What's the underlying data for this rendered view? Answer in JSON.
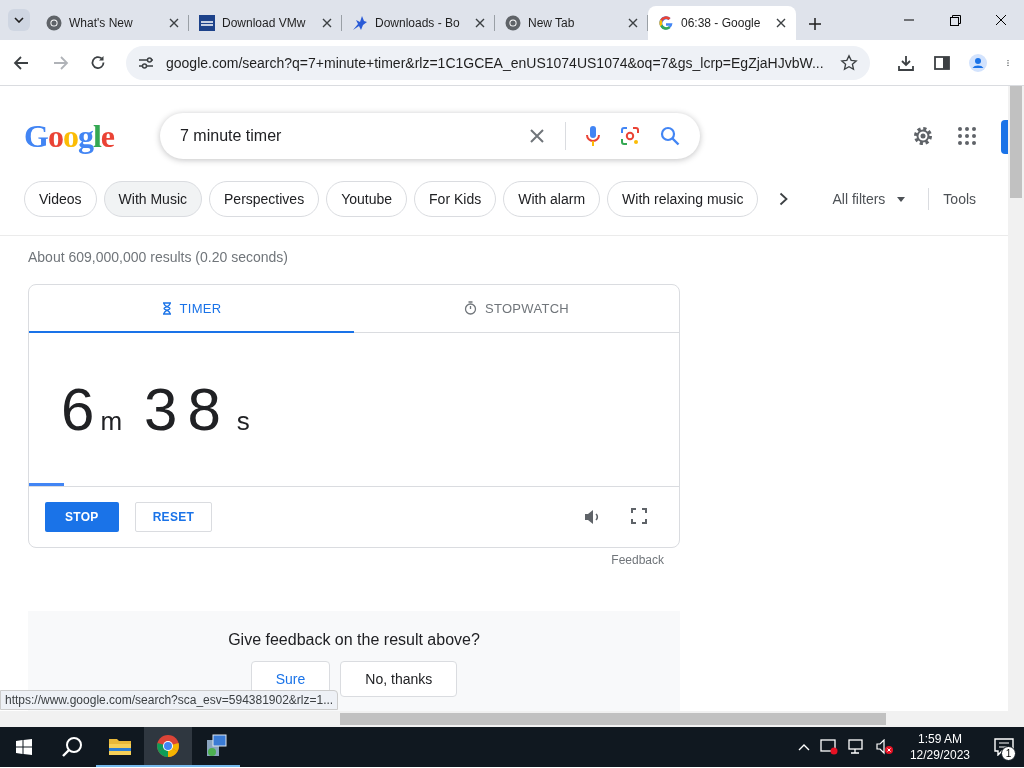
{
  "browser": {
    "tabs": [
      {
        "title": "What's New",
        "kind": "chrome",
        "selected": false
      },
      {
        "title": "Download VMw",
        "kind": "vmware",
        "selected": false
      },
      {
        "title": "Downloads - Bo",
        "kind": "bird",
        "selected": false
      },
      {
        "title": "New Tab",
        "kind": "chrome",
        "selected": false
      },
      {
        "title": "06:38 - Google",
        "kind": "google",
        "selected": true
      }
    ],
    "address": "google.com/search?q=7+minute+timer&rlz=1C1GCEA_enUS1074US1074&oq=7&gs_lcrp=EgZjaHJvbW..."
  },
  "page": {
    "logo": "Google",
    "search": {
      "query": "7 minute timer"
    },
    "chips": [
      {
        "label": "Videos",
        "selected": false
      },
      {
        "label": "With Music",
        "selected": true
      },
      {
        "label": "Perspectives",
        "selected": false
      },
      {
        "label": "Youtube",
        "selected": false
      },
      {
        "label": "For Kids",
        "selected": false
      },
      {
        "label": "With alarm",
        "selected": false
      },
      {
        "label": "With relaxing music",
        "selected": false
      }
    ],
    "all_filters": "All filters",
    "tools": "Tools",
    "result_stats": "About 609,000,000 results (0.20 seconds)",
    "timer": {
      "tabs": [
        {
          "label": "TIMER",
          "kind": "hourglass",
          "selected": true
        },
        {
          "label": "STOPWATCH",
          "kind": "stopwatch",
          "selected": false
        }
      ],
      "minutes": "6",
      "minutes_unit": "m",
      "seconds": "38",
      "seconds_unit": "s",
      "level": 0.054,
      "buttons": [
        {
          "label": "STOP",
          "kind": "primary"
        },
        {
          "label": "RESET",
          "kind": "outline"
        }
      ]
    },
    "feedback_link": "Feedback",
    "feedback_box": {
      "question": "Give feedback on the result above?",
      "buttons": [
        "Sure",
        "No, thanks"
      ]
    }
  },
  "status_url": "https://www.google.com/search?sca_esv=594381902&rlz=1...",
  "taskbar": {
    "apps": [
      {
        "kind": "explorer",
        "selected": false
      },
      {
        "kind": "chrome",
        "selected": true
      },
      {
        "kind": "installer",
        "selected": false
      }
    ],
    "time": "1:59 AM",
    "date": "12/29/2023",
    "notifications": "1"
  }
}
